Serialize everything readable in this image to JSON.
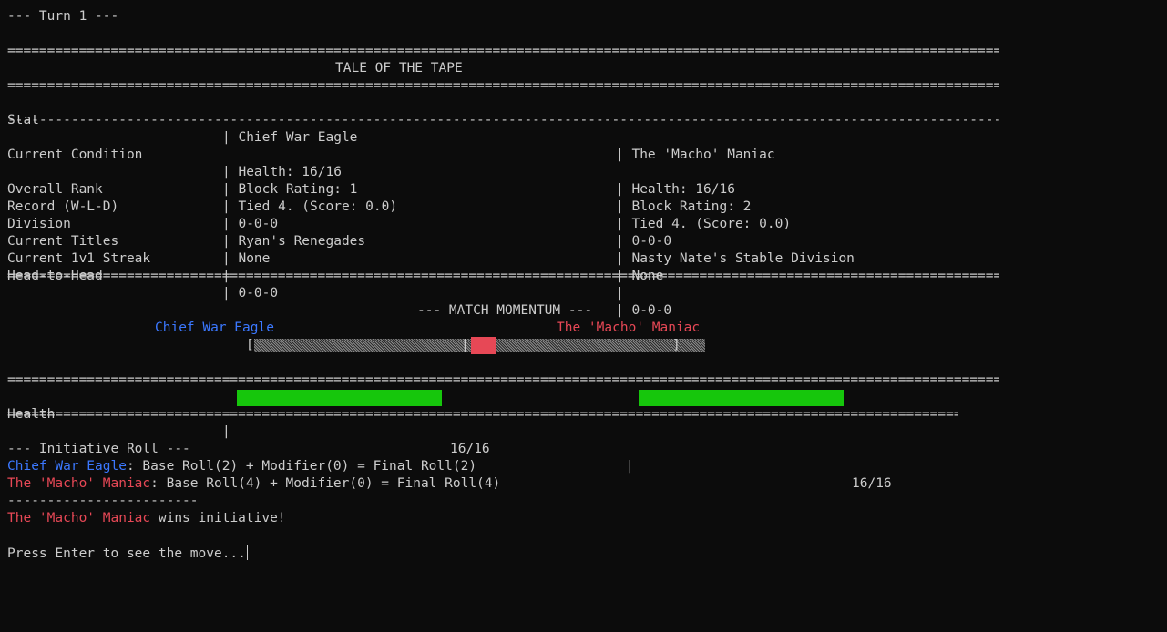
{
  "turn_header": "--- Turn 1 ---",
  "tale": {
    "title": "TALE OF THE TAPE",
    "headers": {
      "stat": "Stat",
      "fighter_a": "Chief War Eagle",
      "fighter_b": "The 'Macho' Maniac"
    },
    "rows": [
      {
        "label": "Current Condition",
        "a": "Health: 16/16",
        "b": "Health: 16/16"
      },
      {
        "label": "",
        "a": "Block Rating: 1",
        "b": "Block Rating: 2"
      },
      {
        "label": "Overall Rank",
        "a": "Tied 4. (Score: 0.0)",
        "b": "Tied 4. (Score: 0.0)"
      },
      {
        "label": "Record (W-L-D)",
        "a": "0-0-0",
        "b": "0-0-0"
      },
      {
        "label": "Division",
        "a": "Ryan's Renegades",
        "b": "Nasty Nate's Stable Division"
      },
      {
        "label": "Current Titles",
        "a": "None",
        "b": "None"
      },
      {
        "label": "Current 1v1 Streak",
        "a": "",
        "b": ""
      },
      {
        "label": "Head-to-Head",
        "a": "0-0-0",
        "b": "0-0-0"
      }
    ]
  },
  "momentum": {
    "title": "--- MATCH MOMENTUM ---",
    "left_name": "Chief War Eagle",
    "right_name": "The 'Macho' Maniac",
    "indicator_fraction": 0.55
  },
  "health": {
    "label": "Health",
    "a_value": "16/16",
    "b_value": "16/16",
    "a_fraction": 1.0,
    "b_fraction": 1.0
  },
  "initiative": {
    "title": "--- Initiative Roll ---",
    "a_name": "Chief War Eagle",
    "a_roll": ": Base Roll(2) + Modifier(0) = Final Roll(2)",
    "b_name": "The 'Macho' Maniac",
    "b_roll": ": Base Roll(4) + Modifier(0) = Final Roll(4)",
    "winner_name": "The 'Macho' Maniac",
    "winner_text": " wins initiative!"
  },
  "prompt": "Press Enter to see the move...",
  "colors": {
    "blue": "#3b78ff",
    "red": "#e74856",
    "green": "#16c60c"
  }
}
